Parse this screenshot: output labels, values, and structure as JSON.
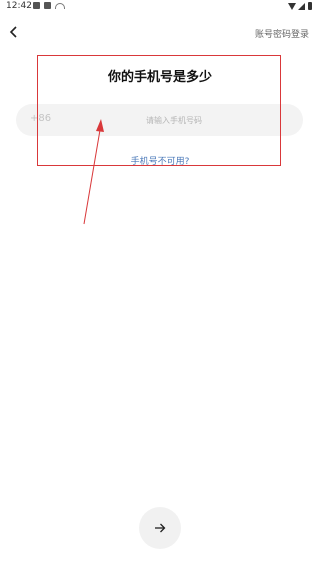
{
  "status_bar": {
    "time": "12:42"
  },
  "header": {
    "back_icon": "arrow-left-icon",
    "account_login_label": "账号密码登录"
  },
  "main": {
    "title": "你的手机号是多少",
    "country_code": "+86",
    "phone_placeholder": "请输入手机号码",
    "phone_value": "",
    "unavailable_link": "手机号不可用?"
  },
  "footer": {
    "next_icon": "arrow-right-icon"
  },
  "annotation": {
    "color": "#d9383a"
  },
  "colors": {
    "link": "#4a78b8",
    "input_bg": "#f3f3f3",
    "button_bg": "#f1f1f1"
  }
}
